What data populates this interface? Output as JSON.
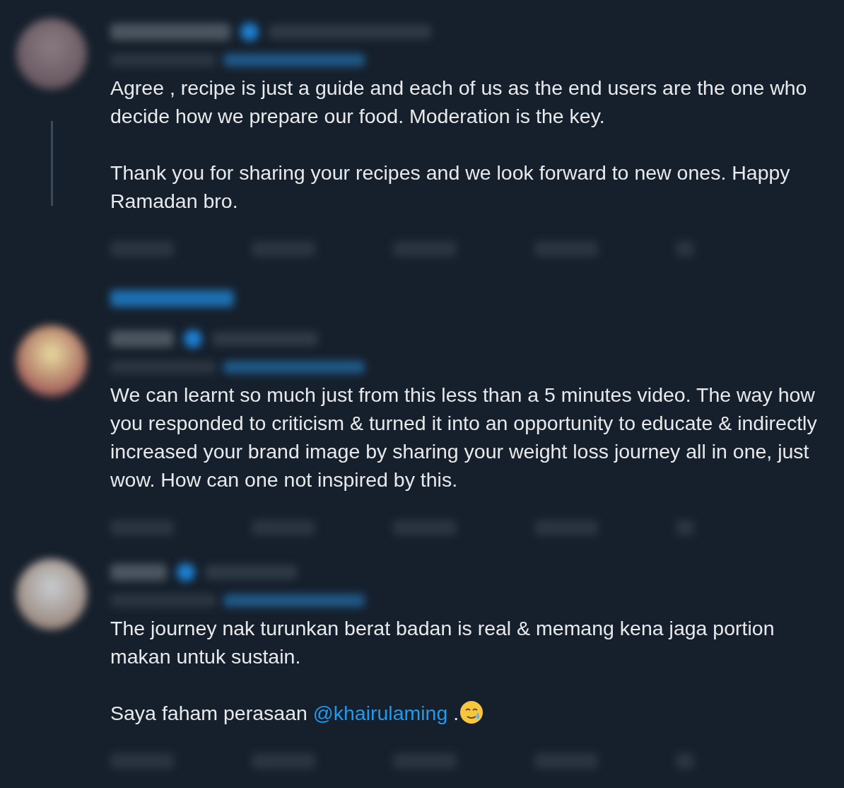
{
  "tweets": [
    {
      "show_replies": true,
      "paragraphs": [
        {
          "parts": [
            {
              "kind": "text",
              "text": "Agree , recipe is just a guide and each of us as the end users are the one who decide how we prepare our food. Moderation is the key."
            }
          ]
        },
        {
          "parts": [
            {
              "kind": "text",
              "text": "Thank you for sharing your recipes and we look forward to new ones. Happy Ramadan bro."
            }
          ]
        }
      ]
    },
    {
      "show_replies": false,
      "paragraphs": [
        {
          "parts": [
            {
              "kind": "text",
              "text": "We can learnt so much just from this less than a 5 minutes video. The way how you responded to criticism & turned it into an opportunity to educate & indirectly increased your brand image by sharing your weight loss journey all in one, just wow. How can one not inspired by this."
            }
          ]
        }
      ]
    },
    {
      "show_replies": false,
      "paragraphs": [
        {
          "parts": [
            {
              "kind": "text",
              "text": "The journey nak turunkan berat badan is real & memang kena jaga portion makan untuk sustain."
            }
          ]
        },
        {
          "parts": [
            {
              "kind": "text",
              "text": "Saya faham perasaan "
            },
            {
              "kind": "mention",
              "text": "@khairulaming"
            },
            {
              "kind": "text",
              "text": " ."
            },
            {
              "kind": "emoji"
            }
          ]
        }
      ]
    }
  ]
}
